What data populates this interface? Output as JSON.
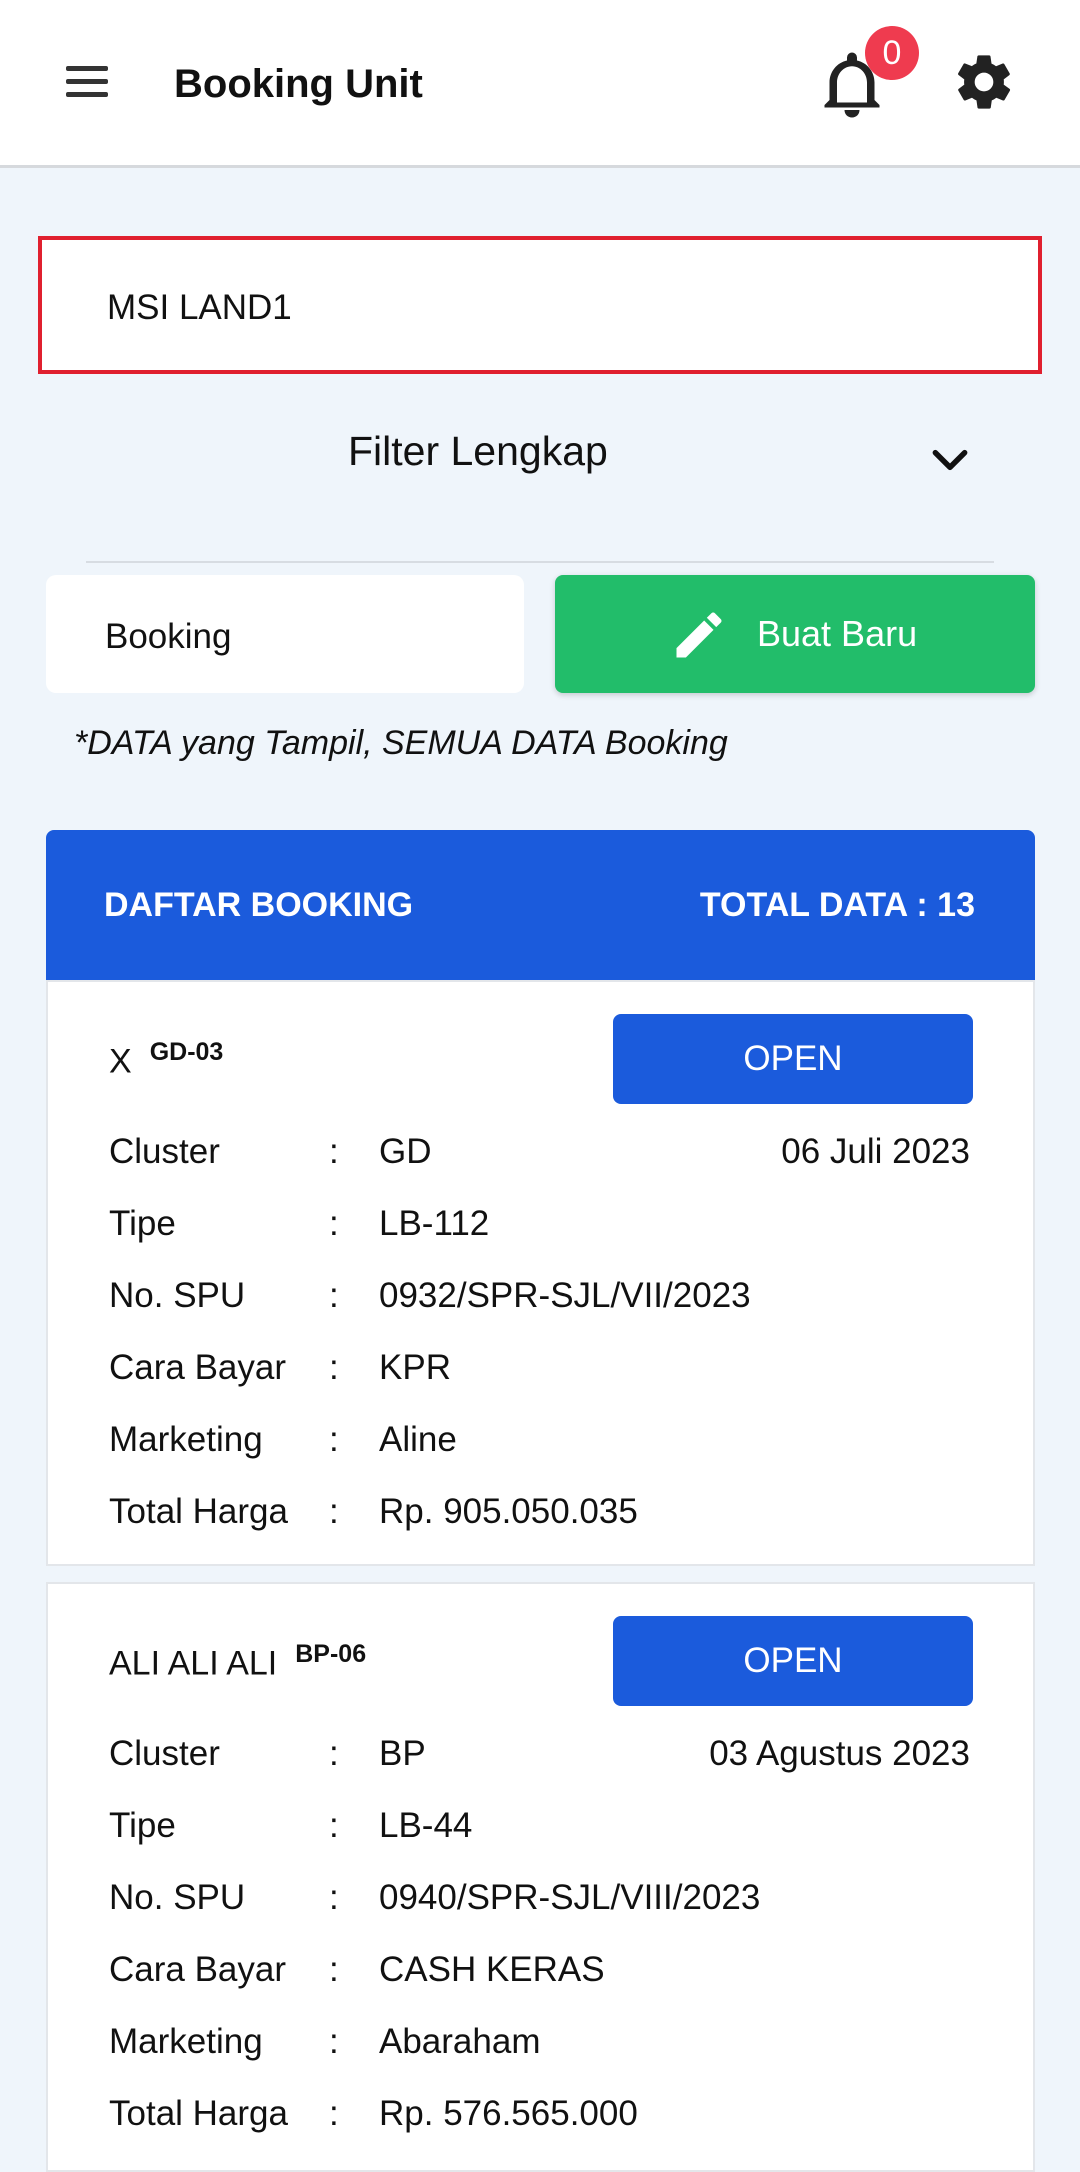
{
  "appbar": {
    "title": "Booking Unit",
    "notification_count": "0"
  },
  "project_field": {
    "value": "MSI LAND1"
  },
  "filter": {
    "label": "Filter Lengkap"
  },
  "booking_select": {
    "value": "Booking"
  },
  "new_button": {
    "label": "Buat Baru"
  },
  "note": "*DATA yang Tampil, SEMUA DATA Booking",
  "list": {
    "title": "DAFTAR BOOKING",
    "total": "TOTAL DATA : 13",
    "field_labels": {
      "cluster": "Cluster",
      "tipe": "Tipe",
      "spu": "No. SPU",
      "cara_bayar": "Cara Bayar",
      "marketing": "Marketing",
      "total_harga": "Total Harga",
      "colon": ":"
    },
    "items": [
      {
        "name": "X",
        "code": "GD-03",
        "button": "OPEN",
        "date": "06 Juli 2023",
        "cluster": "GD",
        "tipe": "LB-112",
        "spu": "0932/SPR-SJL/VII/2023",
        "cara_bayar": "KPR",
        "marketing": "Aline",
        "total_harga": "Rp. 905.050.035"
      },
      {
        "name": "ALI ALI ALI",
        "code": "BP-06",
        "button": "OPEN",
        "date": "03 Agustus 2023",
        "cluster": "BP",
        "tipe": "LB-44",
        "spu": "0940/SPR-SJL/VIII/2023",
        "cara_bayar": "CASH KERAS",
        "marketing": "Abaraham",
        "total_harga": "Rp. 576.565.000"
      }
    ]
  }
}
